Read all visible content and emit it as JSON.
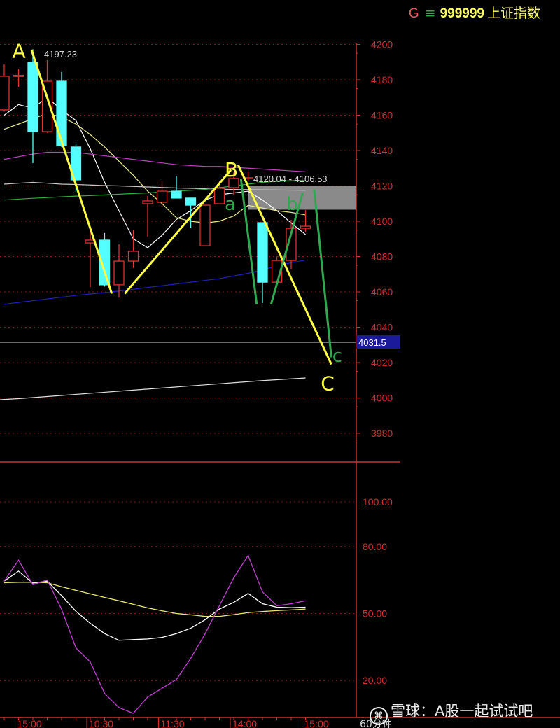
{
  "header": {
    "market_letter": "G",
    "menu_glyph": "≡",
    "code": "999999",
    "name": "上证指数"
  },
  "watermark": {
    "logo": "雪球-logo",
    "text": "雪球：A股一起试试吧"
  },
  "period_label": "60分钟",
  "colors": {
    "up": "#e03030",
    "down": "#54ffff",
    "axis": "#d03030",
    "wave_abc": "#ffff44",
    "wave_sub": "#2fa84f",
    "gap_box": "#8a8a8a",
    "price_tag_bg": "#1a1a9a"
  },
  "chart_data": [
    {
      "type": "candlestick",
      "title": "",
      "y_ticks": [
        4200,
        4180,
        4160,
        4140,
        4120,
        4100,
        4080,
        4060,
        4040,
        4020,
        4000,
        3980
      ],
      "y_tick_labels": [
        "4200",
        "4180",
        "4160",
        "4140",
        "4120",
        "4100",
        "4080",
        "4060",
        "4040",
        "4020",
        "4000",
        "3980"
      ],
      "ylim": [
        3970,
        4200
      ],
      "grid": true,
      "x_tick_labels": [
        "15:00",
        "10:30",
        "11:30",
        "14:00",
        "15:00"
      ],
      "x_tick_candle_index": [
        1,
        6,
        11,
        16,
        21
      ],
      "candles": [
        {
          "o": 4163.0,
          "h": 4188.7,
          "l": 4162.0,
          "c": 4182.0
        },
        {
          "o": 4182.0,
          "h": 4186.0,
          "l": 4176.0,
          "c": 4182.5
        },
        {
          "o": 4189.9,
          "h": 4197.23,
          "l": 4132.9,
          "c": 4150.7
        },
        {
          "o": 4150.7,
          "h": 4191.1,
          "l": 4150.0,
          "c": 4179.2
        },
        {
          "o": 4179.2,
          "h": 4184.4,
          "l": 4142.0,
          "c": 4142.8
        },
        {
          "o": 4142.0,
          "h": 4144.0,
          "l": 4116.6,
          "c": 4123.4
        },
        {
          "o": 4087.7,
          "h": 4094.5,
          "l": 4062.8,
          "c": 4089.3
        },
        {
          "o": 4089.3,
          "h": 4093.3,
          "l": 4063.0,
          "c": 4064.0
        },
        {
          "o": 4064.0,
          "h": 4086.9,
          "l": 4056.8,
          "c": 4077.4
        },
        {
          "o": 4077.4,
          "h": 4094.9,
          "l": 4073.5,
          "c": 4083.0
        },
        {
          "o": 4109.9,
          "h": 4114.3,
          "l": 4091.3,
          "c": 4111.5
        },
        {
          "o": 4110.7,
          "h": 4123.0,
          "l": 4108.3,
          "c": 4117.0
        },
        {
          "o": 4117.0,
          "h": 4125.7,
          "l": 4113.0,
          "c": 4113.1
        },
        {
          "o": 4113.1,
          "h": 4113.1,
          "l": 4096.4,
          "c": 4109.1
        },
        {
          "o": 4086.1,
          "h": 4109.1,
          "l": 4086.1,
          "c": 4109.1
        },
        {
          "o": 4109.9,
          "h": 4122.6,
          "l": 4109.9,
          "c": 4118.6
        },
        {
          "o": 4119.0,
          "h": 4128.1,
          "l": 4115.0,
          "c": 4124.2
        },
        {
          "o": 4124.3,
          "h": 4128.0,
          "l": 4123.0,
          "c": 4124.6
        },
        {
          "o": 4099.2,
          "h": 4099.2,
          "l": 4053.7,
          "c": 4065.5
        },
        {
          "o": 4065.5,
          "h": 4080.0,
          "l": 4065.0,
          "c": 4077.8
        },
        {
          "o": 4077.8,
          "h": 4100.8,
          "l": 4072.7,
          "c": 4096.0
        },
        {
          "o": 4096.0,
          "h": 4106.3,
          "l": 4094.1,
          "c": 4097.2
        }
      ],
      "moving_averages": [
        {
          "color": "#ffffff",
          "values": [
            4160,
            4166,
            4164,
            4170,
            4163,
            4157,
            4141,
            4122,
            4106,
            4090,
            4085,
            4092,
            4101,
            4106,
            4112,
            4115,
            4116,
            4117,
            4112,
            4106,
            4099,
            4092.5
          ]
        },
        {
          "color": "#e8e890",
          "values": [
            4152,
            4155,
            4158,
            4161,
            4159,
            4155,
            4149,
            4142,
            4134,
            4126,
            4117,
            4110,
            4102,
            4100,
            4099,
            4100,
            4103,
            4109,
            4107.5,
            4106,
            4105,
            4103.6
          ]
        },
        {
          "color": "#c040c0",
          "values": [
            4135,
            4136.5,
            4138,
            4139,
            4139,
            4139,
            4138,
            4137,
            4136,
            4135,
            4134,
            4133,
            4132,
            4131.5,
            4131,
            4131,
            4130.5,
            4130,
            4129.5,
            4129,
            4128.5,
            4128
          ]
        },
        {
          "color": "#c8c8c8",
          "values": [
            4121,
            4121.5,
            4122,
            4121.5,
            4121,
            4120.8,
            4120.5,
            4120.2,
            4120,
            4119.7,
            4119.4,
            4119.1,
            4118.8,
            4118.6,
            4118.4,
            4118.2,
            4118,
            4117.9,
            4117.8,
            4117.7,
            4117.6,
            4117.5
          ]
        },
        {
          "color": "#30b040",
          "values": [
            4112,
            4112.5,
            4113,
            4113.4,
            4113.8,
            4114.2,
            4114.5,
            4114.9,
            4115.3,
            4115.7,
            4116,
            4116.5,
            4117,
            4117.5,
            4118,
            4119,
            4120,
            4121,
            4122,
            4122.5,
            4123,
            4123
          ]
        },
        {
          "color": "#2020c0",
          "values": [
            4053,
            4054,
            4055,
            4056,
            4057,
            4058,
            4058.8,
            4059.6,
            4060.5,
            4061.5,
            4062.5,
            4063.5,
            4064.5,
            4065.5,
            4066.5,
            4067.5,
            4069,
            4070.5,
            4072.5,
            4074.6,
            4076.5,
            4078
          ]
        },
        {
          "color": "#e0e0e0",
          "values": [
            3999,
            3999.6,
            4000.2,
            4000.8,
            4001.4,
            4002,
            4002.6,
            4003.2,
            4003.8,
            4004.4,
            4005,
            4005.6,
            4006.2,
            4006.8,
            4007.4,
            4008,
            4008.6,
            4009.2,
            4009.8,
            4010.3,
            4010.8,
            4011.3
          ]
        }
      ],
      "annotations": {
        "high_label": "4197.23",
        "gap_label": "4120.04 - 4106.53",
        "gap_range": [
          4106.53,
          4120.04
        ],
        "current_line_value": 4031.5,
        "current_line_label": "4031.5",
        "wave_labels": [
          {
            "text": "A",
            "color": "yellow",
            "at_candle": 1.1,
            "price": 4196
          },
          {
            "text": "B",
            "color": "yellow",
            "at_candle": 15.9,
            "price": 4129
          },
          {
            "text": "C",
            "color": "yellow",
            "at_candle": 22.6,
            "price": 4008
          },
          {
            "text": "a",
            "color": "green",
            "at_candle": 15.9,
            "price": 4110
          },
          {
            "text": "b",
            "color": "green",
            "at_candle": 20.2,
            "price": 4110
          },
          {
            "text": "c",
            "color": "green",
            "at_candle": 23.4,
            "price": 4024
          }
        ],
        "wave_lines": [
          {
            "color": "yellow",
            "from": [
              1.9,
              4197
            ],
            "to": [
              7.5,
              4059
            ]
          },
          {
            "color": "yellow",
            "from": [
              8.4,
              4059
            ],
            "to": [
              15.8,
              4129
            ]
          },
          {
            "color": "yellow",
            "from": [
              16.3,
              4132
            ],
            "to": [
              22.8,
              4019
            ]
          },
          {
            "color": "green",
            "from": [
              16.5,
              4124
            ],
            "to": [
              17.6,
              4053
            ]
          },
          {
            "color": "green",
            "from": [
              18.6,
              4053
            ],
            "to": [
              20.8,
              4116
            ]
          },
          {
            "color": "green",
            "from": [
              21.6,
              4118
            ],
            "to": [
              22.8,
              4023
            ]
          }
        ]
      }
    },
    {
      "type": "line",
      "title": "",
      "y_ticks": [
        100,
        80,
        50,
        20
      ],
      "y_tick_labels": [
        "100.00",
        "80.00",
        "50.00",
        "20.00"
      ],
      "ylim": [
        4,
        116
      ],
      "grid": true,
      "series": [
        {
          "color": "#c040d0",
          "values": [
            64.5,
            73.9,
            62.9,
            65,
            51.9,
            34.6,
            28.3,
            14.2,
            7.9,
            5.3,
            12.6,
            16.5,
            20.4,
            29.9,
            40.9,
            53.5,
            66,
            76,
            59.7,
            53.5,
            54.4,
            55.7
          ]
        },
        {
          "color": "#ffffff",
          "values": [
            64.5,
            69,
            63.6,
            64.5,
            58,
            51,
            45.6,
            41,
            38,
            38.3,
            38.6,
            39.3,
            41,
            43.4,
            47.2,
            52,
            55,
            59,
            54.4,
            52.8,
            52.6,
            52.8
          ]
        },
        {
          "color": "#e8e870",
          "values": [
            63.8,
            64,
            64,
            63.8,
            62,
            60.4,
            58.8,
            57.2,
            55.7,
            54.1,
            52.5,
            51.2,
            50,
            49.4,
            48.7,
            48.7,
            49.5,
            50.4,
            50.9,
            51.3,
            51.6,
            52
          ]
        }
      ]
    }
  ]
}
